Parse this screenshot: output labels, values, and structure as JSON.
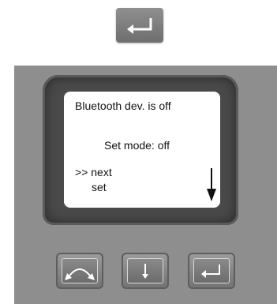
{
  "top_key": {
    "icon": "enter-icon"
  },
  "display": {
    "line1": "Bluetooth dev. is off",
    "line2": "Set mode: off",
    "line3": ">> next",
    "line4": "set",
    "scroll_icon": "down-arrow-icon"
  },
  "keypad": {
    "buttons": [
      {
        "icon": "curved-arrows-icon"
      },
      {
        "icon": "down-arrow-icon"
      },
      {
        "icon": "enter-icon"
      }
    ]
  }
}
